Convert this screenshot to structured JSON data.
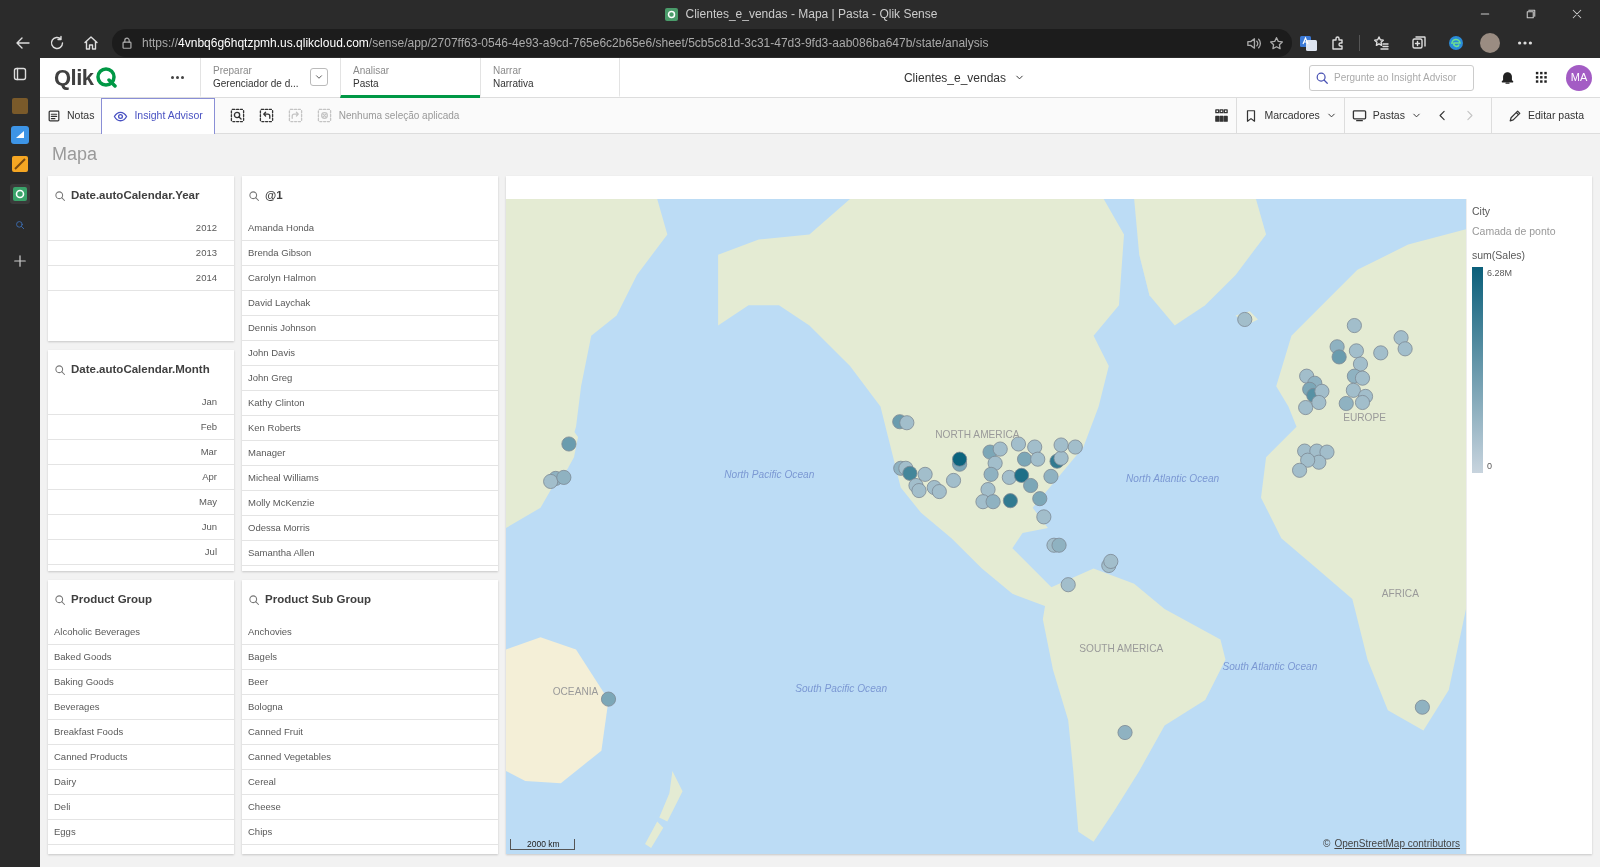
{
  "browser": {
    "title": "Clientes_e_vendas - Mapa | Pasta - Qlik Sense",
    "url": "https://**4vnbq6g6hqtzpmh.us.qlikcloud.com**/sense/app/2707ff63-0546-4e93-a9cd-765e6c2b65e6/sheet/5cb5c81d-3c31-47d3-9fd3-aab086ba647b/state/analysis"
  },
  "header": {
    "logo": "Qlik",
    "tabs": [
      {
        "caption": "Preparar",
        "label": "Gerenciador de d...",
        "selected": false,
        "dropdown": true
      },
      {
        "caption": "Analisar",
        "label": "Pasta",
        "selected": true,
        "dropdown": false
      },
      {
        "caption": "Narrar",
        "label": "Narrativa",
        "selected": false,
        "dropdown": false
      }
    ],
    "app_title": "Clientes_e_vendas",
    "search": {
      "placeholder": "Pergunte ao Insight Advisor"
    },
    "avatar": "MA"
  },
  "toolbar": {
    "notes": "Notas",
    "insight": {
      "label": "Insight Advisor",
      "selected": true
    },
    "tools": [
      {
        "kind": "smart-search",
        "disabled": false
      },
      {
        "kind": "step-back",
        "disabled": false
      },
      {
        "kind": "step-forward",
        "disabled": true
      },
      {
        "kind": "clear",
        "disabled": true
      }
    ],
    "selection_status": "Nenhuma seleção aplicada",
    "bookmarks": "Marcadores",
    "sheets": "Pastas",
    "previous": {
      "disabled": false
    },
    "next": {
      "disabled": true
    },
    "edit": "Editar pasta"
  },
  "sheet_title": "Mapa",
  "filter_panes": [
    {
      "title": "Date.autoCalendar.Year",
      "kind": "numeric",
      "items": [
        "2012",
        "2013",
        "2014"
      ]
    },
    {
      "title": "Date.autoCalendar.Month",
      "kind": "numeric",
      "items": [
        "Jan",
        "Feb",
        "Mar",
        "Apr",
        "May",
        "Jun",
        "Jul"
      ]
    },
    {
      "title": "@1",
      "kind": "text",
      "items": [
        "Amanda Honda",
        "Brenda Gibson",
        "Carolyn Halmon",
        "David Laychak",
        "Dennis Johnson",
        "John Davis",
        "John Greg",
        "Kathy Clinton",
        "Ken Roberts",
        "Manager",
        "Micheal Williams",
        "Molly McKenzie",
        "Odessa Morris",
        "Samantha Allen"
      ]
    },
    {
      "title": "Product Group",
      "kind": "text",
      "items": [
        "Alcoholic Beverages",
        "Baked Goods",
        "Baking Goods",
        "Beverages",
        "Breakfast Foods",
        "Canned Products",
        "Dairy",
        "Deli",
        "Eggs"
      ]
    },
    {
      "title": "Product Sub Group",
      "kind": "text",
      "items": [
        "Anchovies",
        "Bagels",
        "Beer",
        "Bologna",
        "Canned Fruit",
        "Canned Vegetables",
        "Cereal",
        "Cheese",
        "Chips"
      ]
    }
  ],
  "map": {
    "labels": [
      {
        "text": "EUROPE",
        "kind": "continent"
      },
      {
        "text": "NORTH AMERICA",
        "kind": "continent"
      },
      {
        "text": "North Pacific Ocean",
        "kind": "ocean"
      },
      {
        "text": "North Atlantic Ocean",
        "kind": "ocean"
      },
      {
        "text": "AFRICA",
        "kind": "continent"
      },
      {
        "text": "SOUTH AMERICA",
        "kind": "continent"
      },
      {
        "text": "OCEANIA",
        "kind": "continent"
      },
      {
        "text": "South Pacific Ocean",
        "kind": "ocean"
      },
      {
        "text": "South Atlantic Ocean",
        "kind": "ocean"
      }
    ],
    "scale": "2000 km",
    "attribution": {
      "prefix": "©",
      "link": "OpenStreetMap contributors"
    },
    "legend": {
      "title": "City",
      "layer": "Camada de ponto",
      "measure": "sum(Sales)",
      "max": "6.28M",
      "min": "0"
    }
  }
}
